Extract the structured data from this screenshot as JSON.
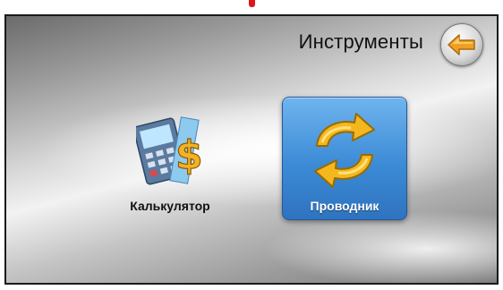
{
  "header": {
    "title": "Инструменты",
    "back_icon": "back-arrow-icon"
  },
  "tools": [
    {
      "label": "Калькулятор",
      "icon": "calculator-icon",
      "selected": false
    },
    {
      "label": "Проводник",
      "icon": "sync-arrows-icon",
      "selected": true
    }
  ],
  "colors": {
    "selected_tile": "#3c8bd6",
    "arrow": "#f0a020",
    "marker": "#e0141e"
  }
}
